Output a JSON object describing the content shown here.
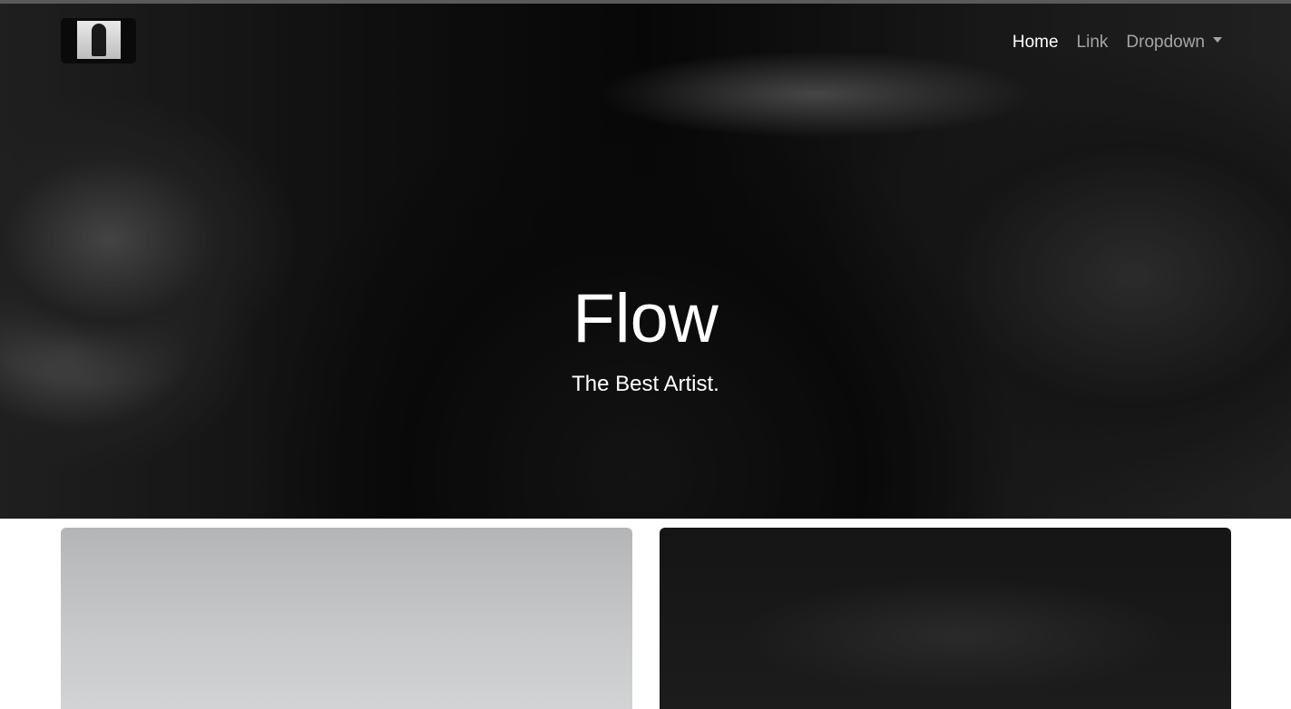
{
  "brand": {
    "logo_icon": "artist-photo-logo"
  },
  "nav": {
    "items": [
      {
        "label": "Home",
        "active": true
      },
      {
        "label": "Link",
        "active": false
      },
      {
        "label": "Dropdown",
        "active": false,
        "has_caret": true
      }
    ]
  },
  "hero": {
    "title": "Flow",
    "subtitle": "The Best Artist."
  },
  "cards": [
    {
      "tone": "light"
    },
    {
      "tone": "dark"
    }
  ],
  "colors": {
    "nav_active": "#ffffff",
    "nav_inactive": "rgba(255,255,255,0.6)",
    "hero_text": "#ffffff"
  }
}
